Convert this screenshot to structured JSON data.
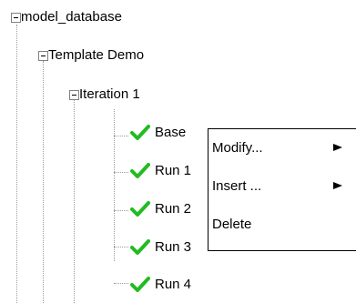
{
  "tree": {
    "root": {
      "label": "model_database",
      "expanded": true
    },
    "project": {
      "label": "Template Demo",
      "expanded": true
    },
    "iteration": {
      "label": "Iteration 1",
      "expanded": true
    },
    "runs": [
      {
        "label": "Base",
        "status": "check-icon"
      },
      {
        "label": "Run 1",
        "status": "check-icon"
      },
      {
        "label": "Run 2",
        "status": "check-icon"
      },
      {
        "label": "Run 3",
        "status": "check-icon"
      },
      {
        "label": "Run 4",
        "status": "check-icon"
      }
    ]
  },
  "context_menu": {
    "items": [
      {
        "label": "Modify...",
        "has_submenu": true
      },
      {
        "label": "Insert ...",
        "has_submenu": true
      },
      {
        "label": "Delete",
        "has_submenu": false
      }
    ]
  },
  "colors": {
    "check": "#22bb22",
    "lines": "#9a9a9a",
    "menu_border": "#000000"
  }
}
